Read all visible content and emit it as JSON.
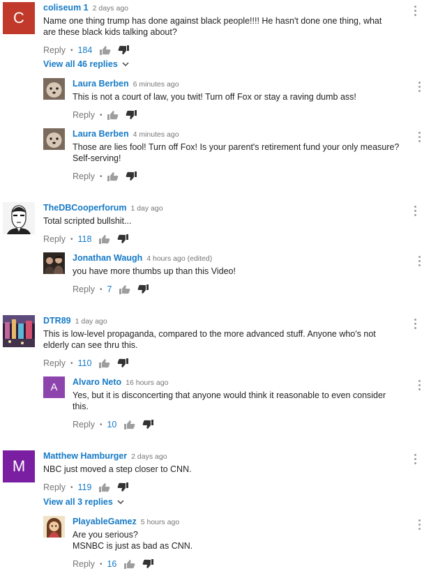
{
  "reply_label": "Reply",
  "dot": "•",
  "colors": {
    "link_blue": "#167ac6",
    "meta_gray": "#767676",
    "avatar_c": "#c0392b",
    "avatar_a": "#8e44ad",
    "avatar_m": "#7b1fa2"
  },
  "threads": [
    {
      "author": "coliseum 1",
      "time": "2 days ago",
      "avatar_letter": "C",
      "text": "Name one thing trump has done against black people!!!! He hasn't done one thing, what are these black kids talking about?",
      "likes": "184",
      "view_all": "View all 46 replies",
      "replies": [
        {
          "author": "Laura Berben",
          "time": "6 minutes ago",
          "text": "This is not a court of law, you twit!  Turn off Fox or stay a raving dumb ass!",
          "likes": ""
        },
        {
          "author": "Laura Berben",
          "time": "4 minutes ago",
          "text": "Those are lies fool!  Turn off Fox!  Is your parent's retirement fund your only measure?  Self-serving!",
          "likes": ""
        }
      ]
    },
    {
      "author": "TheDBCooperforum",
      "time": "1 day ago",
      "text": "Total scripted bullshit...",
      "likes": "118",
      "replies": [
        {
          "author": "Jonathan Waugh",
          "time": "4 hours ago (edited)",
          "text": "you have more thumbs up than this Video!",
          "likes": "7"
        }
      ]
    },
    {
      "author": "DTR89",
      "time": "1 day ago",
      "text": "This is low-level propaganda, compared to the more advanced stuff. Anyone who's not elderly can see thru this.",
      "likes": "110",
      "replies": [
        {
          "author": "Alvaro Neto",
          "time": "16 hours ago",
          "avatar_letter": "A",
          "text": "Yes, but it is disconcerting that anyone would think it reasonable to even consider this.",
          "likes": "10"
        }
      ]
    },
    {
      "author": "Matthew Hamburger",
      "time": "2 days ago",
      "avatar_letter": "M",
      "text": "NBC just moved a step closer to CNN.",
      "likes": "119",
      "view_all": "View all 3 replies",
      "replies": [
        {
          "author": "PlayableGamez",
          "time": "5 hours ago",
          "text": "Are you serious?\nMSNBC is just as bad as CNN.",
          "likes": "16"
        }
      ]
    }
  ]
}
